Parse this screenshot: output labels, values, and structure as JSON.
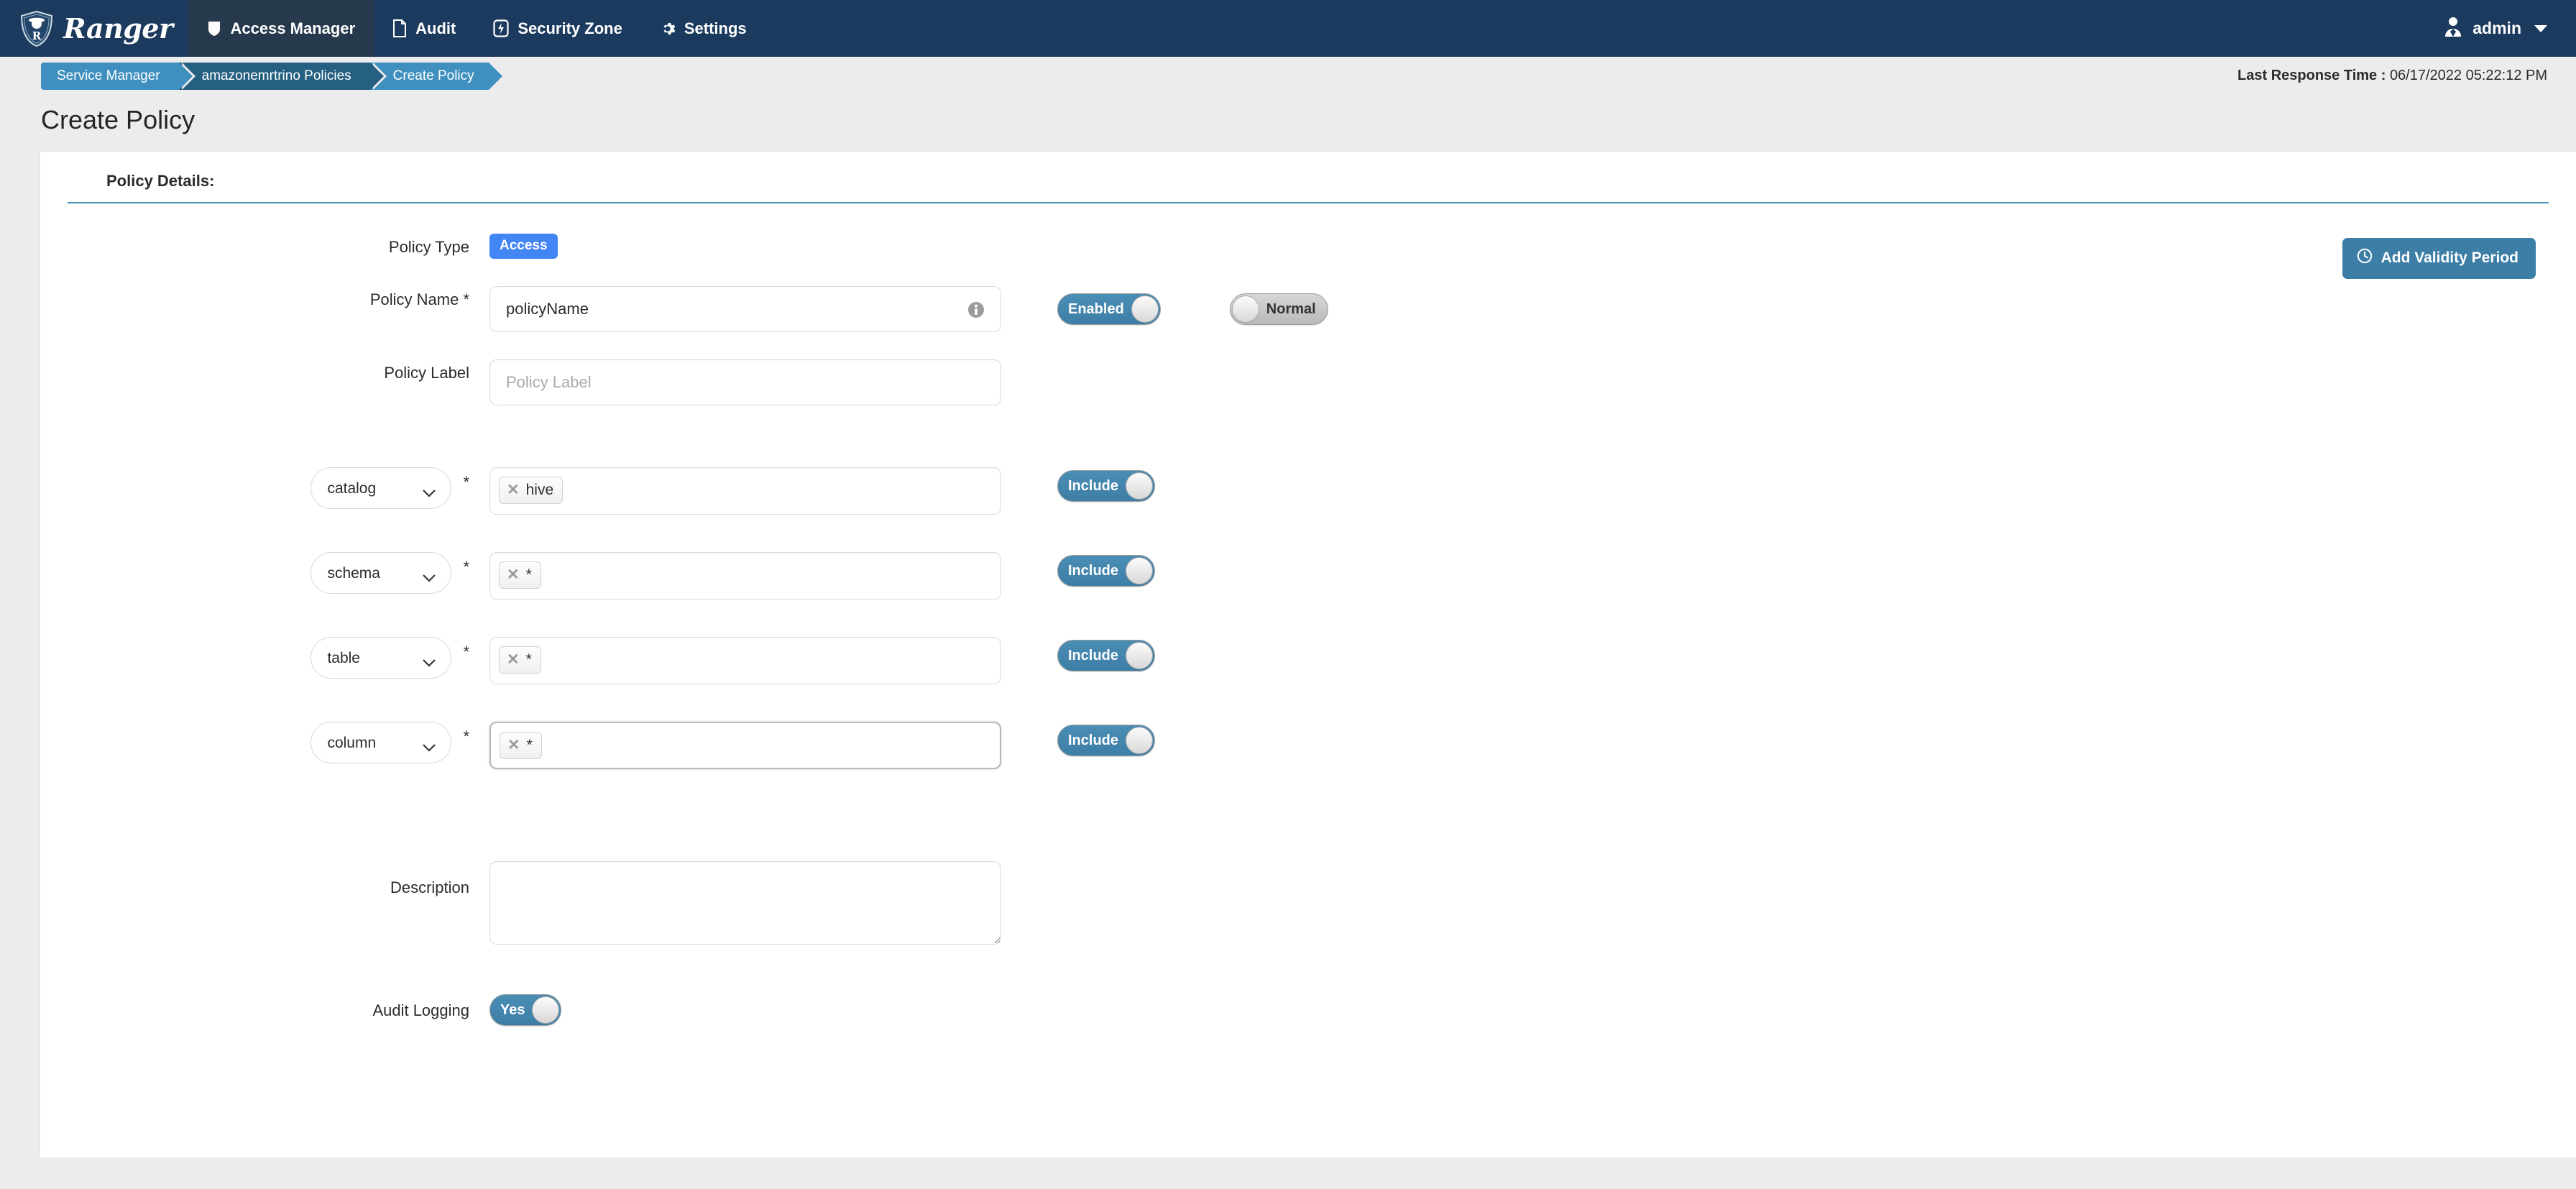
{
  "header": {
    "brand": "Ranger",
    "brand_logo_icon": "ranger-shield-logo",
    "nav": [
      {
        "label": "Access Manager",
        "icon": "shield-icon",
        "active": true
      },
      {
        "label": "Audit",
        "icon": "file-icon",
        "active": false
      },
      {
        "label": "Security Zone",
        "icon": "bolt-square-icon",
        "active": false
      },
      {
        "label": "Settings",
        "icon": "gear-icon",
        "active": false
      }
    ],
    "user": {
      "name": "admin",
      "icon": "user-avatar-icon",
      "caret": "chevron-down-icon"
    }
  },
  "breadcrumb": {
    "items": [
      {
        "label": "Service Manager"
      },
      {
        "label": "amazonemrtrino Policies"
      },
      {
        "label": "Create Policy"
      }
    ]
  },
  "status": {
    "last_response_label": "Last Response Time :",
    "last_response_value": "06/17/2022 05:22:12 PM"
  },
  "page": {
    "title": "Create Policy",
    "section_title": "Policy Details:"
  },
  "form": {
    "policy_type": {
      "label": "Policy Type",
      "value": "Access"
    },
    "validity_button": {
      "label": "Add Validity Period",
      "icon": "clock-icon"
    },
    "policy_name": {
      "label": "Policy Name *",
      "value": "policyName",
      "placeholder": "Policy Name",
      "info_icon": "info-circle-icon",
      "enabled_toggle": {
        "label": "Enabled",
        "state": "on"
      },
      "priority_toggle": {
        "label": "Normal",
        "state": "off"
      }
    },
    "policy_label": {
      "label": "Policy Label",
      "value": "",
      "placeholder": "Policy Label"
    },
    "resources": [
      {
        "select_value": "catalog",
        "required": "*",
        "chips": [
          "hive"
        ],
        "toggle": {
          "label": "Include",
          "state": "on"
        },
        "focused": false
      },
      {
        "select_value": "schema",
        "required": "*",
        "chips": [
          "*"
        ],
        "toggle": {
          "label": "Include",
          "state": "on"
        },
        "focused": false
      },
      {
        "select_value": "table",
        "required": "*",
        "chips": [
          "*"
        ],
        "toggle": {
          "label": "Include",
          "state": "on"
        },
        "focused": false
      },
      {
        "select_value": "column",
        "required": "*",
        "chips": [
          "*"
        ],
        "toggle": {
          "label": "Include",
          "state": "on"
        },
        "focused": true
      }
    ],
    "description": {
      "label": "Description",
      "value": "",
      "placeholder": ""
    },
    "audit_logging": {
      "label": "Audit Logging",
      "toggle": {
        "label": "Yes",
        "state": "on"
      }
    }
  },
  "colors": {
    "navbar": "#1c3a5e",
    "nav_active": "#27394d",
    "crumb_light": "#3f8fbf",
    "crumb_dark": "#256083",
    "accent_blue": "#3d7ea6",
    "badge_blue": "#4285f4",
    "page_bg": "#ececec",
    "card_bg": "#ffffff",
    "section_rule": "#4a90b8"
  }
}
